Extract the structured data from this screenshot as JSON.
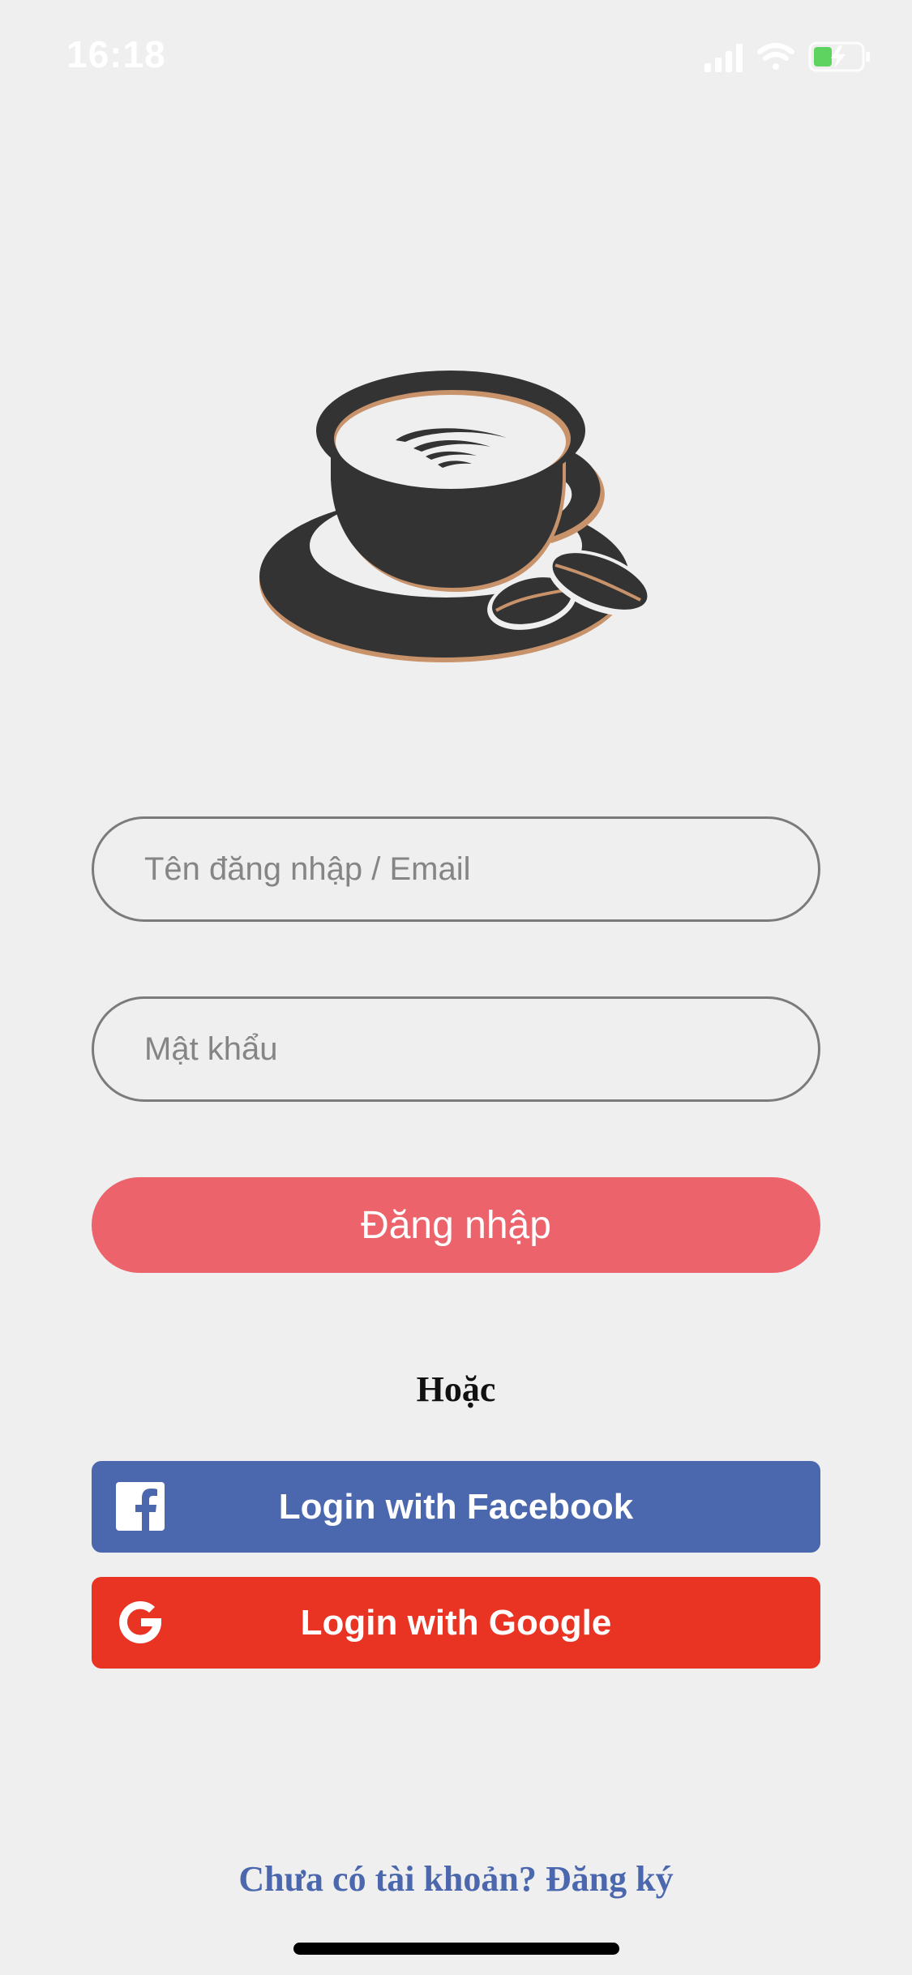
{
  "status_bar": {
    "time": "16:18",
    "icons": [
      "signal-icon",
      "wifi-icon",
      "battery-charging-icon"
    ]
  },
  "logo": {
    "icon": "coffee-cup-logo",
    "colors": {
      "cup": "#333333",
      "accent": "#c8926a"
    }
  },
  "form": {
    "username_placeholder": "Tên đăng nhập / Email",
    "password_placeholder": "Mật khẩu",
    "login_label": "Đăng nhập"
  },
  "divider_text": "Hoặc",
  "social": {
    "facebook_label": "Login with Facebook",
    "google_label": "Login with Google"
  },
  "signup_text": "Chưa có tài khoản? Đăng ký",
  "colors": {
    "background": "#efefef",
    "login_button": "#ec636b",
    "facebook": "#4b67ad",
    "google": "#e93424",
    "link": "#4b67ad"
  }
}
